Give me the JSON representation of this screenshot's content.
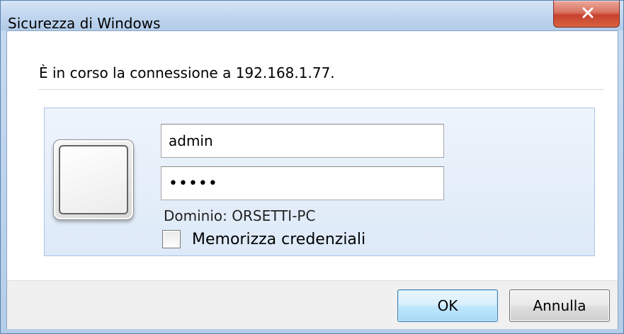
{
  "window": {
    "title": "Sicurezza di Windows",
    "close_label": "×"
  },
  "dialog": {
    "message": "È in corso la connessione a 192.168.1.77.",
    "username_value": "admin",
    "password_value": "•••••",
    "domain_text": "Dominio: ORSETTI-PC",
    "remember_label": "Memorizza credenziali",
    "remember_checked": false
  },
  "buttons": {
    "ok_label": "OK",
    "cancel_label": "Annulla"
  },
  "icons": {
    "close": "close-icon",
    "user_tile": "user-tile-icon"
  },
  "colors": {
    "titlebar": "#bfd5ee",
    "close_button": "#c7412d",
    "ok_border": "#3c7fb1",
    "panel": "#dde9f8"
  }
}
